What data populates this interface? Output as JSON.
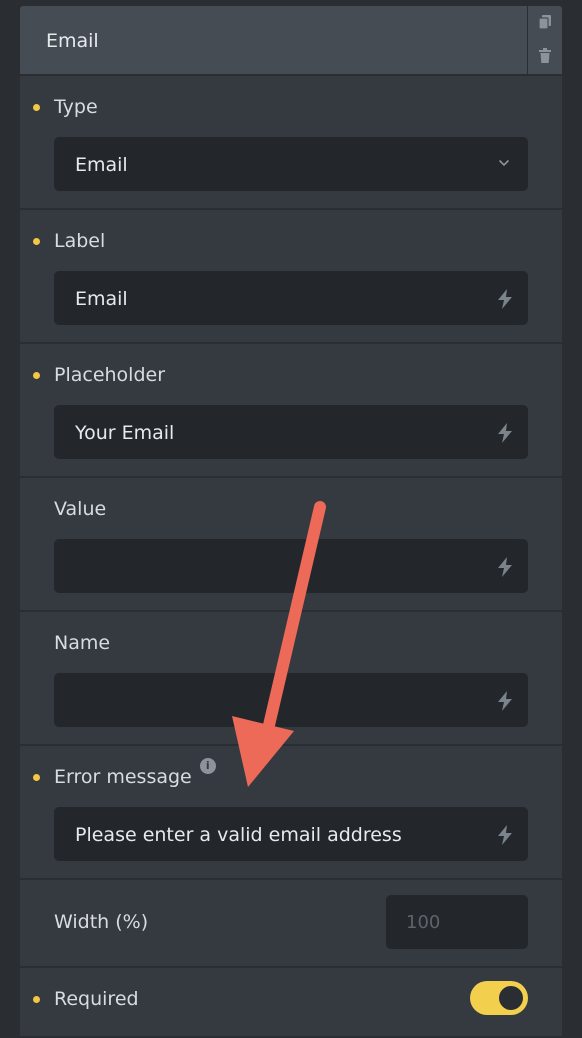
{
  "element": {
    "title": "Email",
    "actions": {
      "copy_icon": "copy-icon",
      "delete_icon": "trash-icon"
    }
  },
  "fields": {
    "type": {
      "label": "Type",
      "value": "Email",
      "icon": "chevron-down-icon"
    },
    "label": {
      "label": "Label",
      "value": "Email",
      "icon": "lightning-icon"
    },
    "placeholder": {
      "label": "Placeholder",
      "value": "Your Email",
      "icon": "lightning-icon"
    },
    "value": {
      "label": "Value",
      "value": "",
      "icon": "lightning-icon"
    },
    "name": {
      "label": "Name",
      "value": "",
      "icon": "lightning-icon"
    },
    "error_message": {
      "label": "Error message",
      "value": "Please enter a valid email address",
      "icon": "lightning-icon",
      "info_icon": "info-icon"
    },
    "width": {
      "label": "Width (%)",
      "placeholder": "100"
    },
    "required": {
      "label": "Required",
      "enabled": true
    }
  },
  "colors": {
    "accent": "#f3c646",
    "toggle_on": "#f2d04d",
    "annotation_arrow": "#ee6a58",
    "panel_bg": "#353a40",
    "input_bg": "#23262a"
  }
}
